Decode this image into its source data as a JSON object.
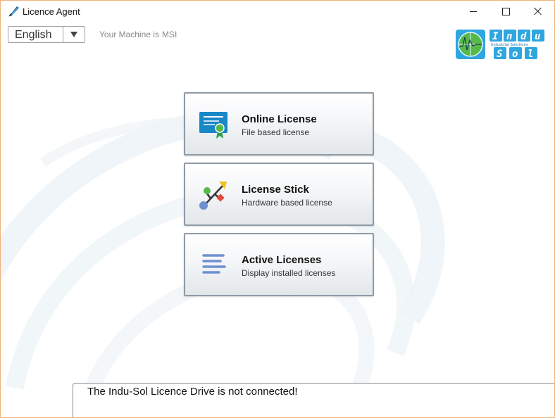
{
  "window": {
    "title": "Licence Agent",
    "controls": [
      "minimize",
      "maximize",
      "close"
    ]
  },
  "language": {
    "selected": "English"
  },
  "machine": {
    "label": "Your Machine is",
    "name": "MSI"
  },
  "logo": {
    "lines": [
      "Indu",
      "Sol"
    ],
    "tagline": "Industrial Solutions",
    "brand_color": "#29a9e1"
  },
  "cards": [
    {
      "title": "Online License",
      "subtitle": "File based license",
      "icon": "certificate-icon"
    },
    {
      "title": "License Stick",
      "subtitle": "Hardware based license",
      "icon": "usb-icon"
    },
    {
      "title": "Active Licenses",
      "subtitle": "Display installed licenses",
      "icon": "list-icon"
    }
  ],
  "status": {
    "message": "The Indu-Sol Licence Drive is not connected!"
  },
  "colors": {
    "accent": "#1a87c9",
    "window_border": "#f0b27a",
    "card_border": "#8e9aa6"
  }
}
